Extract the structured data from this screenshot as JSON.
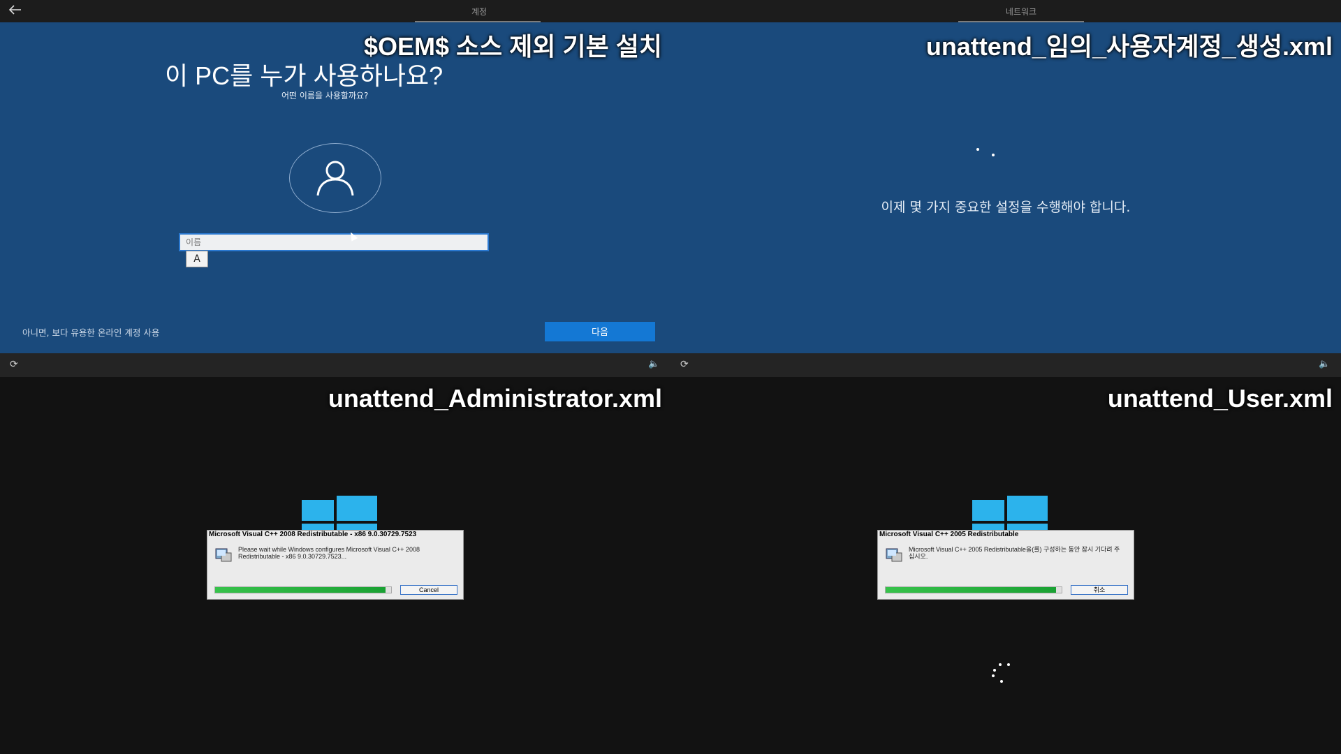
{
  "top_left": {
    "tabs": [
      "계정"
    ],
    "overlay_title": "$OEM$ 소스 제외 기본 설치",
    "heading": "이 PC를 누가 사용하나요?",
    "subheading": "어떤 이름을 사용할까요?",
    "name_placeholder": "이름",
    "ime_indicator": "A",
    "online_account_link": "아니면, 보다 유용한 온라인 계정 사용",
    "next_button": "다음",
    "icons": [
      "back-arrow-icon",
      "user-avatar-icon",
      "ease-of-access-icon",
      "volume-icon"
    ]
  },
  "top_right": {
    "tabs": [
      "네트워크"
    ],
    "overlay_title": "unattend_임의_사용자계정_생성.xml",
    "message": "이제 몇 가지 중요한 설정을 수행해야 합니다.",
    "icons": [
      "ease-of-access-icon",
      "volume-icon"
    ]
  },
  "bottom_left": {
    "overlay_title": "unattend_Administrator.xml",
    "dialog": {
      "title": "Microsoft Visual C++ 2008 Redistributable - x86 9.0.30729.7523",
      "message": "Please wait while Windows configures Microsoft Visual C++ 2008 Redistributable - x86 9.0.30729.7523...",
      "progress": 0.97,
      "button": "Cancel"
    },
    "icons": [
      "windows-logo-icon",
      "installer-icon"
    ]
  },
  "bottom_right": {
    "overlay_title": "unattend_User.xml",
    "dialog": {
      "title": "Microsoft Visual C++ 2005 Redistributable",
      "message": "Microsoft Visual C++ 2005 Redistributable을(를) 구성하는 동안 잠시 기다려 주십시오.",
      "progress": 0.97,
      "button": "취소"
    },
    "icons": [
      "windows-logo-icon",
      "installer-icon",
      "loading-spinner-icon"
    ]
  },
  "colors": {
    "oobe_blue": "#1a4a7c",
    "accent_button": "#1478d4",
    "win_logo": "#2cb3ec",
    "progress_green": "#1aa133"
  }
}
